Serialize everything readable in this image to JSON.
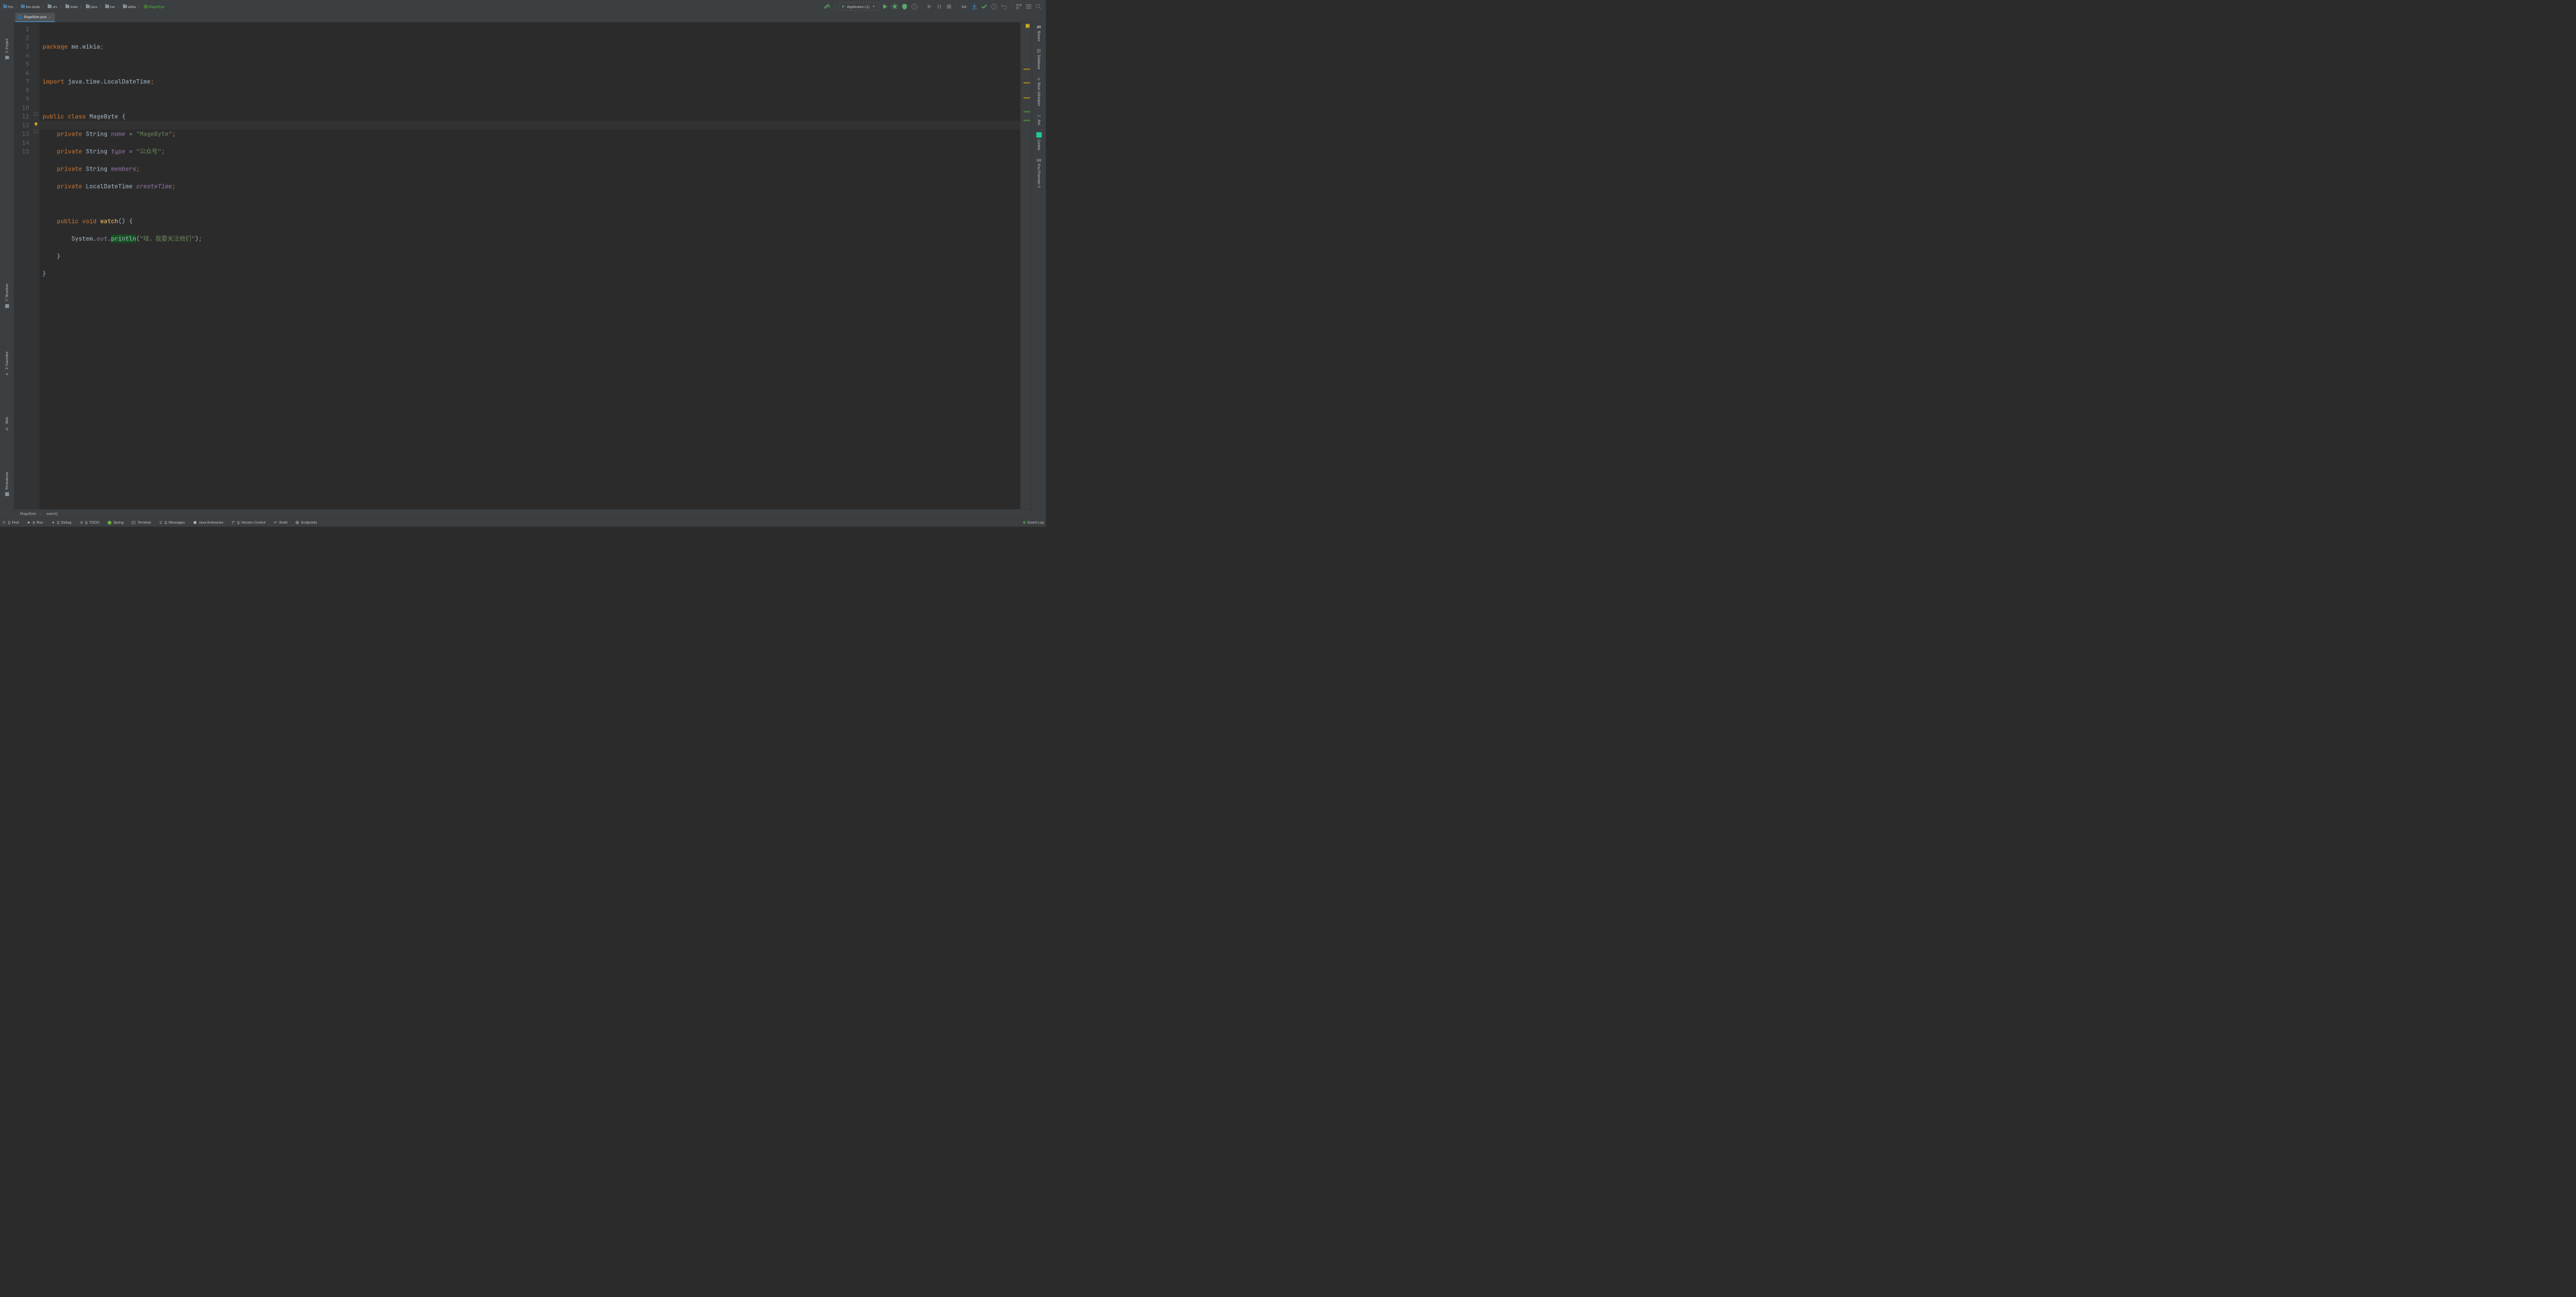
{
  "breadcrumbs": [
    {
      "type": "module",
      "label": "foo"
    },
    {
      "type": "module",
      "label": "foo-dudu"
    },
    {
      "type": "folder",
      "label": "src"
    },
    {
      "type": "folder",
      "label": "main"
    },
    {
      "type": "folder",
      "label": "java"
    },
    {
      "type": "folder",
      "label": "me"
    },
    {
      "type": "folder",
      "label": "wikia"
    },
    {
      "type": "class",
      "label": "MageByte"
    }
  ],
  "run_config": {
    "label": "Application (1)"
  },
  "git_label": "Git:",
  "tab": {
    "label": "MageByte.java"
  },
  "left_tools": [
    {
      "label": "1: Project"
    },
    {
      "label": "7: Structure"
    },
    {
      "label": "2: Favorites"
    },
    {
      "label": "Web"
    },
    {
      "label": "Persistence"
    }
  ],
  "right_tools": [
    {
      "label": "Maven",
      "glyph": "m"
    },
    {
      "label": "Database"
    },
    {
      "label": "Bean Validation"
    },
    {
      "label": "Ant"
    },
    {
      "label": "Codota"
    },
    {
      "label": "Key Promoter X"
    }
  ],
  "code": {
    "lines": 15,
    "current_line": 12,
    "l1": {
      "kw": "package ",
      "pkg": "me.wikia",
      "semi": ";"
    },
    "l3": {
      "kw": "import ",
      "pkg": "java.time.LocalDateTime",
      "semi": ";"
    },
    "l5": {
      "kw1": "public ",
      "kw2": "class ",
      "cls": "MageByte ",
      "brace": "{"
    },
    "l6": {
      "kw": "private ",
      "typ": "String ",
      "fld": "name ",
      "eq": "= ",
      "str": "\"MageByte\"",
      "semi": ";"
    },
    "l7": {
      "kw": "private ",
      "typ": "String ",
      "fld": "type ",
      "eq": "= ",
      "str": "\"公众号\"",
      "semi": ";"
    },
    "l8": {
      "kw": "private ",
      "typ": "String ",
      "fld": "members",
      "semi": ";"
    },
    "l9": {
      "kw": "private ",
      "typ": "LocalDateTime ",
      "fld": "createTime",
      "semi": ";"
    },
    "l11": {
      "kw1": "public ",
      "kw2": "void ",
      "mth": "watch",
      "paren": "() {",
      "brace": ""
    },
    "l12": {
      "sys": "System.",
      "out": "out",
      "dot": ".",
      "mth": "println",
      "open": "(",
      "str": "\"哇，我要关注他们\"",
      "close": ")",
      "semi": ";"
    },
    "l13": {
      "brace": "}"
    },
    "l14": {
      "brace": "}"
    }
  },
  "crumb_bottom": [
    "MageByte",
    "watch()"
  ],
  "bottom_tabs": [
    {
      "u": "3",
      "label": ": Find"
    },
    {
      "u": "4",
      "label": ": Run"
    },
    {
      "u": "5",
      "label": ": Debug"
    },
    {
      "u": "6",
      "label": ": TODO"
    },
    {
      "u": "",
      "label": "Spring"
    },
    {
      "u": "",
      "label": "Terminal"
    },
    {
      "u": "0",
      "label": ": Messages"
    },
    {
      "u": "",
      "label": "Java Enterprise"
    },
    {
      "u": "9",
      "label": ": Version Control"
    },
    {
      "u": "",
      "label": "Build"
    },
    {
      "u": "",
      "label": "Endpoints"
    }
  ],
  "event_log": "Event Log"
}
